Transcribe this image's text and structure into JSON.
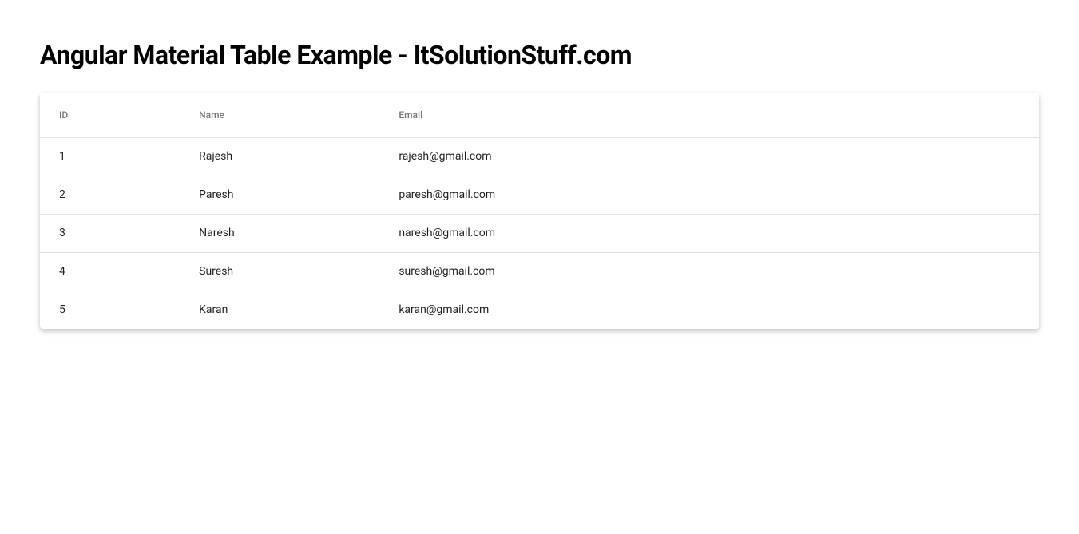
{
  "page": {
    "title": "Angular Material Table Example - ItSolutionStuff.com"
  },
  "table": {
    "columns": {
      "id": "ID",
      "name": "Name",
      "email": "Email"
    },
    "rows": [
      {
        "id": "1",
        "name": "Rajesh",
        "email": "rajesh@gmail.com"
      },
      {
        "id": "2",
        "name": "Paresh",
        "email": "paresh@gmail.com"
      },
      {
        "id": "3",
        "name": "Naresh",
        "email": "naresh@gmail.com"
      },
      {
        "id": "4",
        "name": "Suresh",
        "email": "suresh@gmail.com"
      },
      {
        "id": "5",
        "name": "Karan",
        "email": "karan@gmail.com"
      }
    ]
  }
}
